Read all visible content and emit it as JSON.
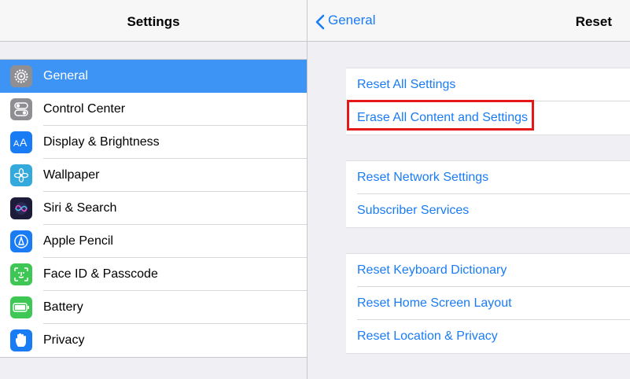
{
  "left_pane": {
    "title": "Settings",
    "items": [
      {
        "label": "General",
        "icon": "gear-icon",
        "color": "#8e8e93",
        "selected": true
      },
      {
        "label": "Control Center",
        "icon": "toggles-icon",
        "color": "#8e8e93"
      },
      {
        "label": "Display & Brightness",
        "icon": "text-size-icon",
        "color": "#1a7cf5"
      },
      {
        "label": "Wallpaper",
        "icon": "flower-icon",
        "color": "#34aadc"
      },
      {
        "label": "Siri & Search",
        "icon": "siri-icon",
        "color": "#1c1c3a"
      },
      {
        "label": "Apple Pencil",
        "icon": "pencil-icon",
        "color": "#1a7cf5"
      },
      {
        "label": "Face ID & Passcode",
        "icon": "face-id-icon",
        "color": "#3ec754"
      },
      {
        "label": "Battery",
        "icon": "battery-icon",
        "color": "#3ec754"
      },
      {
        "label": "Privacy",
        "icon": "hand-icon",
        "color": "#1a7cf5"
      }
    ]
  },
  "right_pane": {
    "back_label": "General",
    "title": "Reset",
    "groups": [
      [
        "Reset All Settings",
        "Erase All Content and Settings"
      ],
      [
        "Reset Network Settings",
        "Subscriber Services"
      ],
      [
        "Reset Keyboard Dictionary",
        "Reset Home Screen Layout",
        "Reset Location & Privacy"
      ]
    ]
  },
  "colors": {
    "accent": "#1a7cf5",
    "selection": "#3e94f5",
    "highlight": "#e41818"
  }
}
